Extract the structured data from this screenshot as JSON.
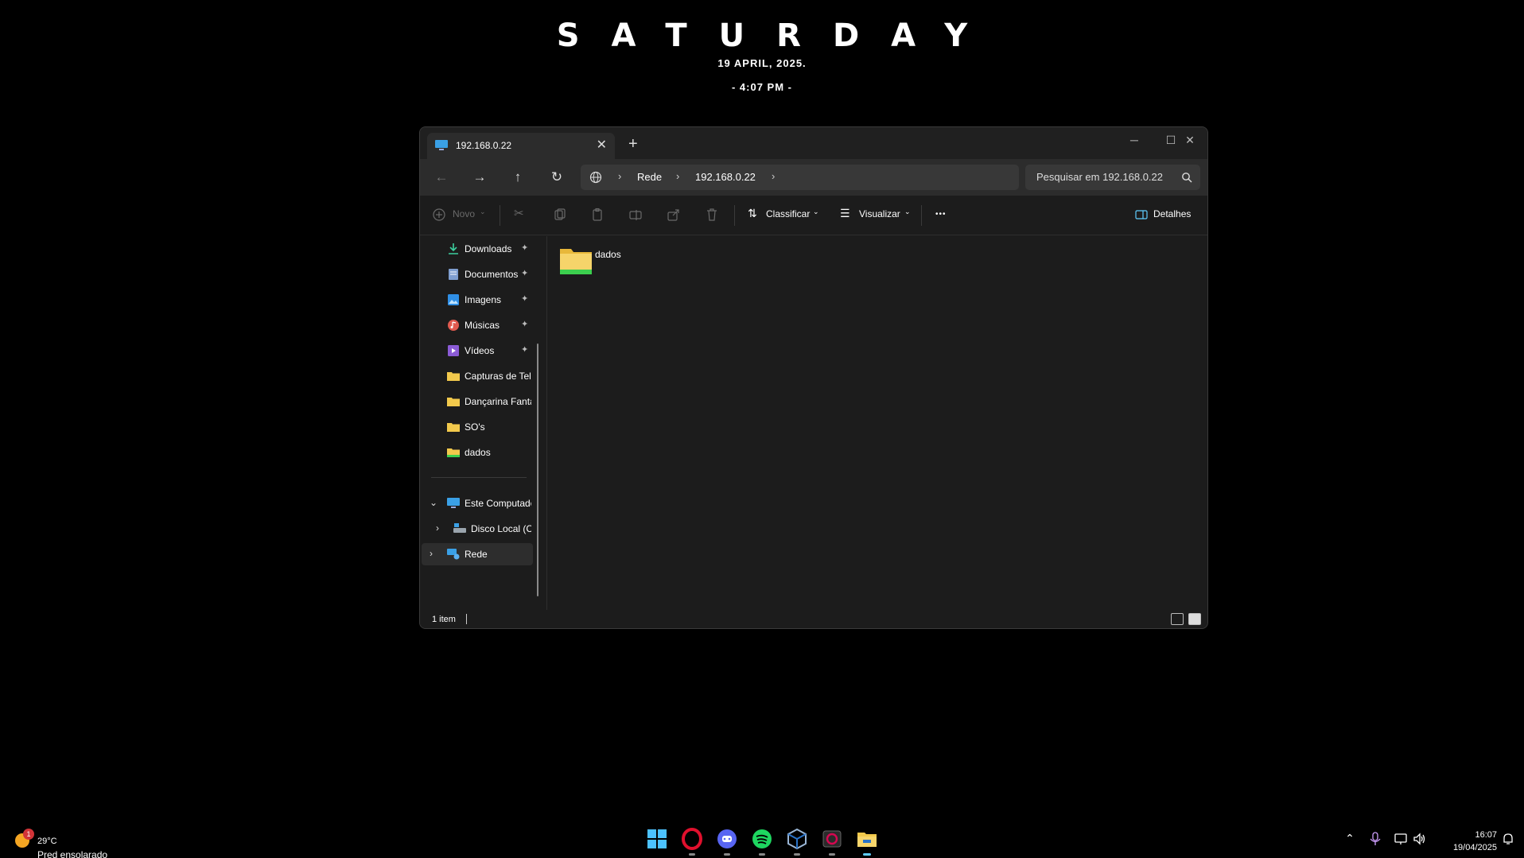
{
  "widget": {
    "day": "SATURDAY",
    "date": "19 APRIL, 2025.",
    "time": "- 4:07 PM -"
  },
  "window": {
    "tab_title": "192.168.0.22",
    "new_tab": "+",
    "minimize": "─",
    "maximize": "☐",
    "close": "✕"
  },
  "nav": {
    "back": "←",
    "forward": "→",
    "up": "↑",
    "refresh": "↻",
    "breadcrumbs": [
      "Rede",
      "192.168.0.22"
    ],
    "search_placeholder": "Pesquisar em 192.168.0.22"
  },
  "toolbar": {
    "new_label": "Novo",
    "sort_label": "Classificar",
    "view_label": "Visualizar",
    "more_label": "•••",
    "details_label": "Detalhes"
  },
  "sidebar": {
    "quick_access": [
      {
        "label": "Downloads",
        "icon": "download-icon",
        "pinned": true
      },
      {
        "label": "Documentos",
        "icon": "document-icon",
        "pinned": true
      },
      {
        "label": "Imagens",
        "icon": "image-icon",
        "pinned": true
      },
      {
        "label": "Músicas",
        "icon": "music-icon",
        "pinned": true
      },
      {
        "label": "Vídeos",
        "icon": "video-icon",
        "pinned": true
      },
      {
        "label": "Capturas de Tela",
        "icon": "folder-icon",
        "pinned": false
      },
      {
        "label": "Dançarina Fantasma",
        "icon": "folder-icon",
        "pinned": false
      },
      {
        "label": "SO's",
        "icon": "folder-icon",
        "pinned": false
      },
      {
        "label": "dados",
        "icon": "network-folder-icon",
        "pinned": false
      }
    ],
    "pin_glyph": "📌",
    "this_pc": "Este Computador",
    "local_disk": "Disco Local (C:)",
    "network": "Rede"
  },
  "content": {
    "items": [
      {
        "name": "dados",
        "type": "network-folder"
      }
    ]
  },
  "status": {
    "count": "1 item"
  },
  "taskbar": {
    "weather_temp": "29°C",
    "weather_desc": "Pred ensolarado",
    "weather_badge": "1",
    "apps": [
      "start-icon",
      "opera-icon",
      "discord-icon",
      "spotify-icon",
      "virtualbox-icon",
      "debian-icon",
      "file-explorer-icon"
    ],
    "clock_time": "16:07",
    "clock_date": "19/04/2025"
  },
  "colors": {
    "accent": "#60cdff",
    "folder": "#f2c94c",
    "network_green": "#3ccf4e"
  }
}
